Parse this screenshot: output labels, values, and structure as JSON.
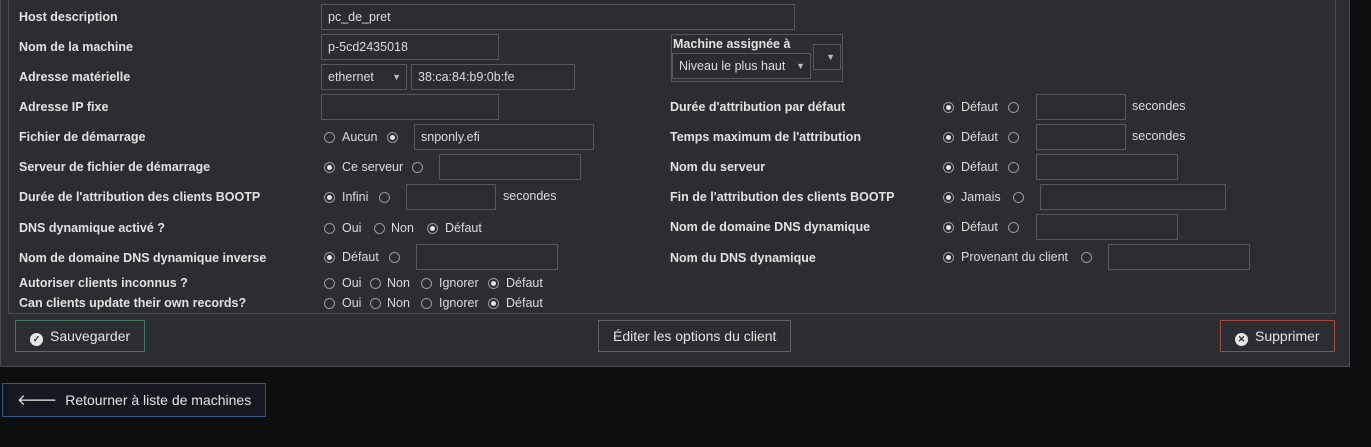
{
  "left_labels": {
    "host_description": "Host description",
    "machine_name": "Nom de la machine",
    "hardware_address": "Adresse matérielle",
    "fixed_ip": "Adresse IP fixe",
    "boot_file": "Fichier de démarrage",
    "boot_server": "Serveur de fichier de démarrage",
    "bootp_lease": "Durée de l'attribution des clients BOOTP",
    "dyn_dns": "DNS dynamique activé ?",
    "reverse_dns_domain": "Nom de domaine DNS dynamique inverse",
    "unknown_clients": "Autoriser clients inconnus ?",
    "client_updates": "Can clients update their own records?"
  },
  "right_labels": {
    "assigned_machine": "Machine assignée à",
    "default_lease": "Durée d'attribution par défaut",
    "max_lease": "Temps maximum de l'attribution",
    "server_name": "Nom du serveur",
    "bootp_end": "Fin de l'attribution des clients BOOTP",
    "dyn_dns_domain": "Nom de domaine DNS dynamique",
    "dyn_dns_name": "Nom du DNS dynamique"
  },
  "values": {
    "host_description": "pc_de_pret",
    "machine_name": "p-5cd2435018",
    "hw_type": "ethernet",
    "hw_address": "38:ca:84:b9:0b:fe",
    "boot_filename": "snponly.efi",
    "assigned_level": "Niveau le plus haut"
  },
  "options": {
    "aucun": "Aucun",
    "ce_serveur": "Ce serveur",
    "infini": "Infini",
    "secondes": "secondes",
    "oui": "Oui",
    "non": "Non",
    "defaut": "Défaut",
    "ignorer": "Ignorer",
    "jamais": "Jamais",
    "provenant": "Provenant du client"
  },
  "buttons": {
    "save": "Sauvegarder",
    "client_options": "Éditer les options du client",
    "delete": "Supprimer",
    "back": "Retourner à liste de machines"
  }
}
